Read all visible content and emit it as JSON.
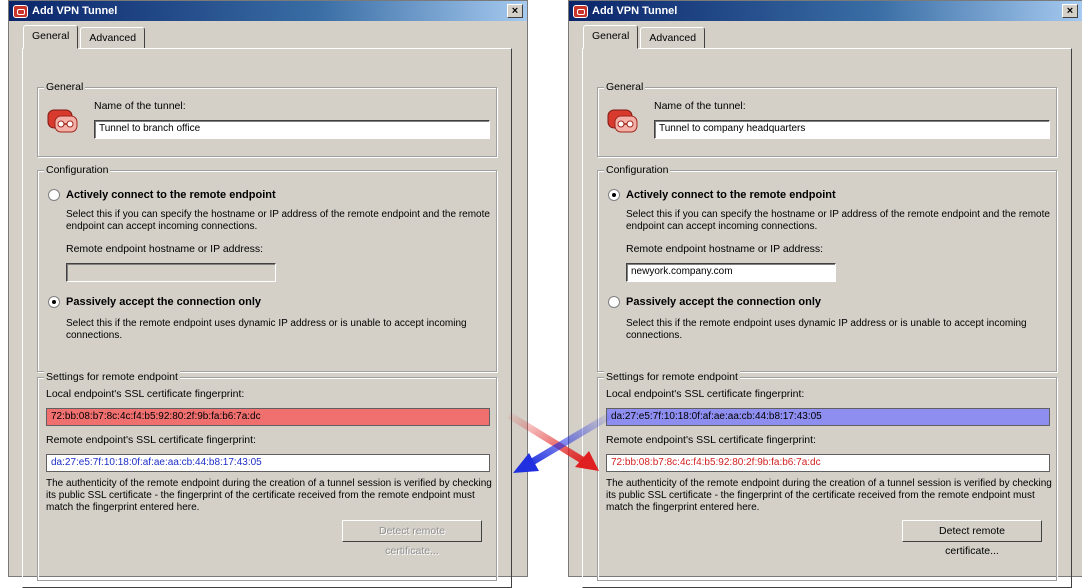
{
  "left_window": {
    "title": "Add VPN Tunnel",
    "tabs": [
      "General",
      "Advanced"
    ],
    "general": {
      "group_title": "General",
      "name_label": "Name of the tunnel:",
      "name_value": "Tunnel to branch office"
    },
    "configuration": {
      "group_title": "Configuration",
      "active_label": "Actively connect to the remote endpoint",
      "active_selected": false,
      "active_desc": "Select this if you can specify the hostname or IP address of the remote endpoint and the remote endpoint can accept incoming connections.",
      "host_label": "Remote endpoint hostname or IP address:",
      "host_value": "",
      "passive_label": "Passively accept the connection only",
      "passive_selected": true,
      "passive_desc": "Select this if the remote endpoint uses dynamic IP address or is unable to accept incoming connections."
    },
    "settings": {
      "group_title": "Settings for remote endpoint",
      "local_label": "Local endpoint's SSL certificate fingerprint:",
      "local_value": "72:bb:08:b7:8c:4c:f4:b5:92:80:2f:9b:fa:b6:7a:dc",
      "remote_label": "Remote endpoint's SSL certificate fingerprint:",
      "remote_value": "da:27:e5:7f:10:18:0f:af:ae:aa:cb:44:b8:17:43:05",
      "info": "The authenticity of the remote endpoint during the creation of a tunnel session is verified by checking its public SSL certificate - the fingerprint of the certificate received from the remote endpoint must match the fingerprint entered here.",
      "detect_button": "Detect remote certificate...",
      "detect_enabled": false
    }
  },
  "right_window": {
    "title": "Add VPN Tunnel",
    "tabs": [
      "General",
      "Advanced"
    ],
    "general": {
      "group_title": "General",
      "name_label": "Name of the tunnel:",
      "name_value": "Tunnel to company headquarters"
    },
    "configuration": {
      "group_title": "Configuration",
      "active_label": "Actively connect to the remote endpoint",
      "active_selected": true,
      "active_desc": "Select this if you can specify the hostname or IP address of the remote endpoint and the remote endpoint can accept incoming connections.",
      "host_label": "Remote endpoint hostname or IP address:",
      "host_value": "newyork.company.com",
      "passive_label": "Passively accept the connection only",
      "passive_selected": false,
      "passive_desc": "Select this if the remote endpoint uses dynamic IP address or is unable to accept incoming connections."
    },
    "settings": {
      "group_title": "Settings for remote endpoint",
      "local_label": "Local endpoint's SSL certificate fingerprint:",
      "local_value": "da:27:e5:7f:10:18:0f:af:ae:aa:cb:44:b8:17:43:05",
      "remote_label": "Remote endpoint's SSL certificate fingerprint:",
      "remote_value": "72:bb:08:b7:8c:4c:f4:b5:92:80:2f:9b:fa:b6:7a:dc",
      "info": "The authenticity of the remote endpoint during the creation of a tunnel session is verified by checking its public SSL certificate - the fingerprint of the certificate received from the remote endpoint must match the fingerprint entered here.",
      "detect_button": "Detect remote certificate...",
      "detect_enabled": true
    }
  },
  "colors": {
    "red_highlight": "#f07070",
    "blue_highlight": "#8e8ef0",
    "red_arrow": "#e02020",
    "blue_arrow": "#2030e0"
  }
}
